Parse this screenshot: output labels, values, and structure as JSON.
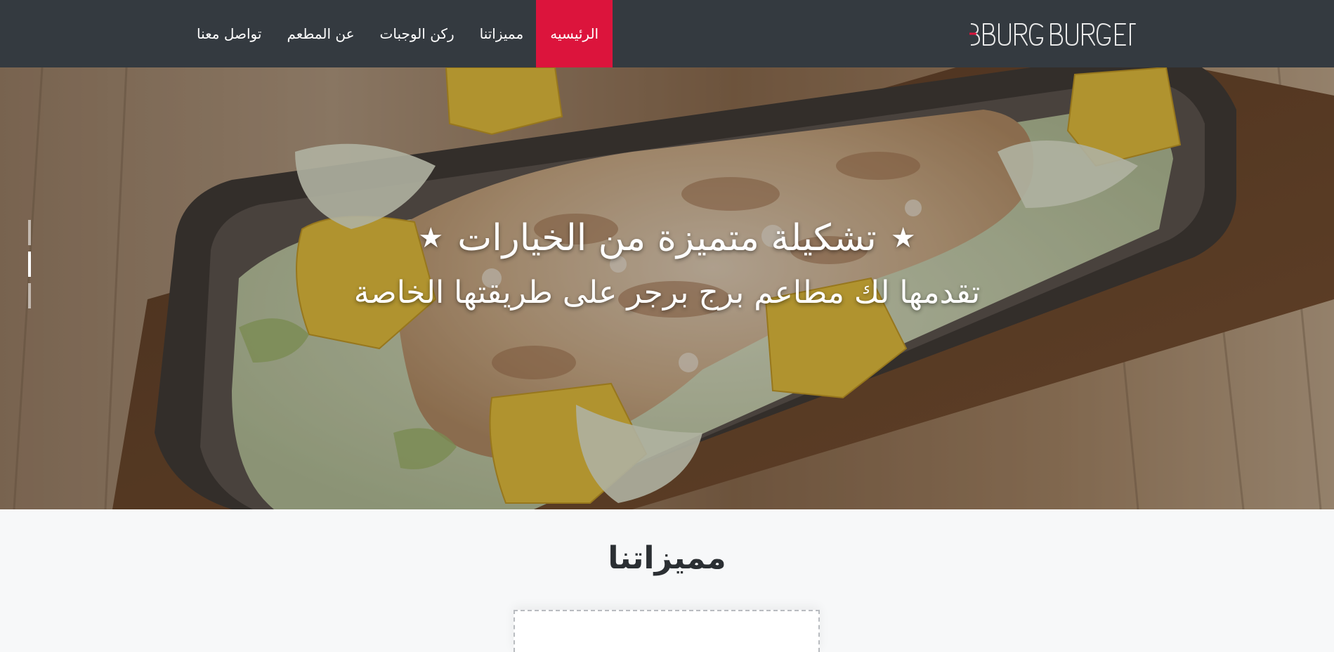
{
  "brand": {
    "name": "BURG BURGER",
    "logo_text": "BURG BURGER",
    "accent": "#dc143c"
  },
  "nav": {
    "items": [
      {
        "label": "الرئيسيه",
        "active": true
      },
      {
        "label": "مميزاتنا",
        "active": false
      },
      {
        "label": "ركن الوجبات",
        "active": false
      },
      {
        "label": "عن المطعم",
        "active": false
      },
      {
        "label": "تواصل معنا",
        "active": false
      }
    ]
  },
  "hero": {
    "title": "تشكيلة متميزة من الخيارات",
    "subtitle": "تقدمها لك مطاعم برج برجر على طريقتها الخاصة",
    "star_icon": "★",
    "slides": 3,
    "active_slide": 2
  },
  "features": {
    "title": "مميزاتنا"
  },
  "colors": {
    "navbar_bg": "#343a40",
    "active_nav_bg": "#dc143c",
    "section_bg": "#f7f8f9"
  }
}
